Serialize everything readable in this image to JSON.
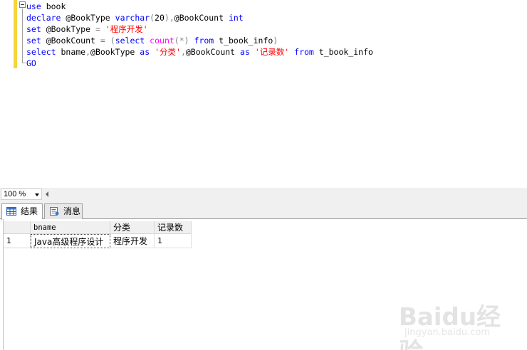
{
  "editor": {
    "lines": [
      [
        {
          "t": "use",
          "c": "kw"
        },
        {
          "t": " book",
          "c": "id"
        }
      ],
      [
        {
          "t": "declare",
          "c": "kw"
        },
        {
          "t": " @BookType ",
          "c": "id"
        },
        {
          "t": "varchar",
          "c": "kw"
        },
        {
          "t": "(",
          "c": "op"
        },
        {
          "t": "20",
          "c": "id"
        },
        {
          "t": "),",
          "c": "op"
        },
        {
          "t": "@BookCount ",
          "c": "id"
        },
        {
          "t": "int",
          "c": "kw"
        }
      ],
      [
        {
          "t": "set",
          "c": "kw"
        },
        {
          "t": " @BookType ",
          "c": "id"
        },
        {
          "t": "=",
          "c": "op"
        },
        {
          "t": " ",
          "c": "id"
        },
        {
          "t": "'程序开发'",
          "c": "str"
        }
      ],
      [
        {
          "t": "set",
          "c": "kw"
        },
        {
          "t": " @BookCount ",
          "c": "id"
        },
        {
          "t": "=",
          "c": "op"
        },
        {
          "t": " ",
          "c": "id"
        },
        {
          "t": "(",
          "c": "op"
        },
        {
          "t": "select",
          "c": "kw"
        },
        {
          "t": " ",
          "c": "id"
        },
        {
          "t": "count",
          "c": "fn"
        },
        {
          "t": "(*)",
          "c": "op"
        },
        {
          "t": " ",
          "c": "id"
        },
        {
          "t": "from",
          "c": "kw"
        },
        {
          "t": " t_book_info",
          "c": "id"
        },
        {
          "t": ")",
          "c": "op"
        }
      ],
      [
        {
          "t": "select",
          "c": "kw"
        },
        {
          "t": " bname",
          "c": "id"
        },
        {
          "t": ",",
          "c": "op"
        },
        {
          "t": "@BookType ",
          "c": "id"
        },
        {
          "t": "as",
          "c": "kw"
        },
        {
          "t": " ",
          "c": "id"
        },
        {
          "t": "'分类'",
          "c": "str"
        },
        {
          "t": ",",
          "c": "op"
        },
        {
          "t": "@BookCount ",
          "c": "id"
        },
        {
          "t": "as",
          "c": "kw"
        },
        {
          "t": " ",
          "c": "id"
        },
        {
          "t": "'记录数'",
          "c": "str"
        },
        {
          "t": " ",
          "c": "id"
        },
        {
          "t": "from",
          "c": "kw"
        },
        {
          "t": " t_book_info",
          "c": "id"
        }
      ],
      [
        {
          "t": "GO",
          "c": "kw"
        }
      ]
    ]
  },
  "zoom": {
    "value": "100 %"
  },
  "tabs": {
    "results_label": "结果",
    "messages_label": "消息"
  },
  "grid": {
    "columns": [
      "bname",
      "分类",
      "记录数"
    ],
    "rows": [
      {
        "num": "1",
        "cells": [
          "Java高级程序设计",
          "程序开发",
          "1"
        ]
      }
    ]
  },
  "watermark": {
    "brand": "Baidu经验",
    "url": "jingyan.baidu.com"
  },
  "colors": {
    "keyword": "#0000ff",
    "string": "#ff0000",
    "function": "#ff00ff",
    "operator": "#808080",
    "change_bar": "#f5d53a"
  }
}
